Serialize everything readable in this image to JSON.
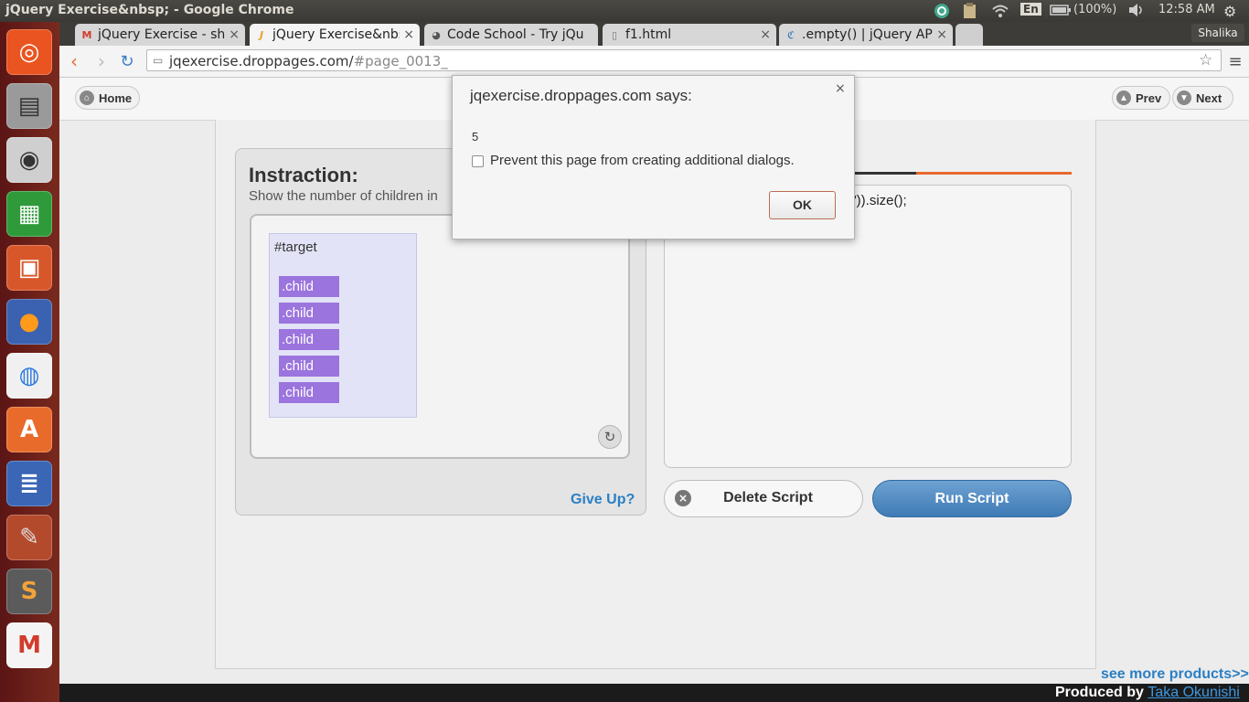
{
  "window": {
    "title": "jQuery Exercise&nbsp; - Google Chrome"
  },
  "panel": {
    "lang": "En",
    "battery": "(100%)",
    "time": "12:58 AM"
  },
  "tabs": [
    {
      "label": "jQuery Exercise - sha",
      "icon": "gmail-icon"
    },
    {
      "label": "jQuery Exercise&nbs",
      "icon": "jqexercise-icon"
    },
    {
      "label": "Code School - Try jQu",
      "icon": "codeschool-icon"
    },
    {
      "label": "f1.html",
      "icon": "file-icon"
    },
    {
      "label": ".empty() | jQuery API",
      "icon": "jquery-icon"
    }
  ],
  "profile": "Shalika",
  "address": {
    "host": "jqexercise.droppages.com/",
    "path": "#page_0013_"
  },
  "header": {
    "home": "Home",
    "prev": "Prev",
    "next": "Next"
  },
  "instruction": {
    "title": "Instraction:",
    "text": "Show the number of children in",
    "target_label": "#target",
    "children": [
      ".child",
      ".child",
      ".child",
      ".child",
      ".child"
    ],
    "give_up": "Give Up?"
  },
  "editor": {
    "code": "d\")).size();"
  },
  "buttons": {
    "delete": "Delete Script",
    "run": "Run Script"
  },
  "footer": {
    "see_more": "see more products>>",
    "produced_by": "Produced by ",
    "author": "Taka Okunishi"
  },
  "dialog": {
    "title": "jqexercise.droppages.com says:",
    "message": "5",
    "checkbox_label": "Prevent this page from creating additional dialogs.",
    "ok": "OK"
  },
  "colors": {
    "accent_orange": "#e8692e",
    "link_blue": "#2a7fc4",
    "child_purple": "#9b74dd",
    "run_blue": "#4a86c0"
  }
}
